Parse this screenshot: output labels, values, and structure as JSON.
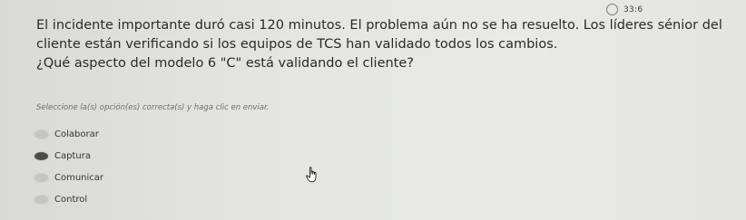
{
  "timer": {
    "text": "33:6"
  },
  "question": {
    "paragraph_1": "El incidente importante duró casi 120 minutos. El problema aún no se ha resuelto. Los líderes sénior del cliente están verificando si los equipos de TCS han validado todos los cambios.",
    "paragraph_2": "¿Qué aspecto del modelo 6 \"C\" está validando el cliente?"
  },
  "instruction": "Seleccione la(s) opción(es) correcta(s) y haga clic en enviar.",
  "options": [
    {
      "label": "Colaborar",
      "selected": false
    },
    {
      "label": "Captura",
      "selected": true
    },
    {
      "label": "Comunicar",
      "selected": false
    },
    {
      "label": "Control",
      "selected": false
    }
  ]
}
